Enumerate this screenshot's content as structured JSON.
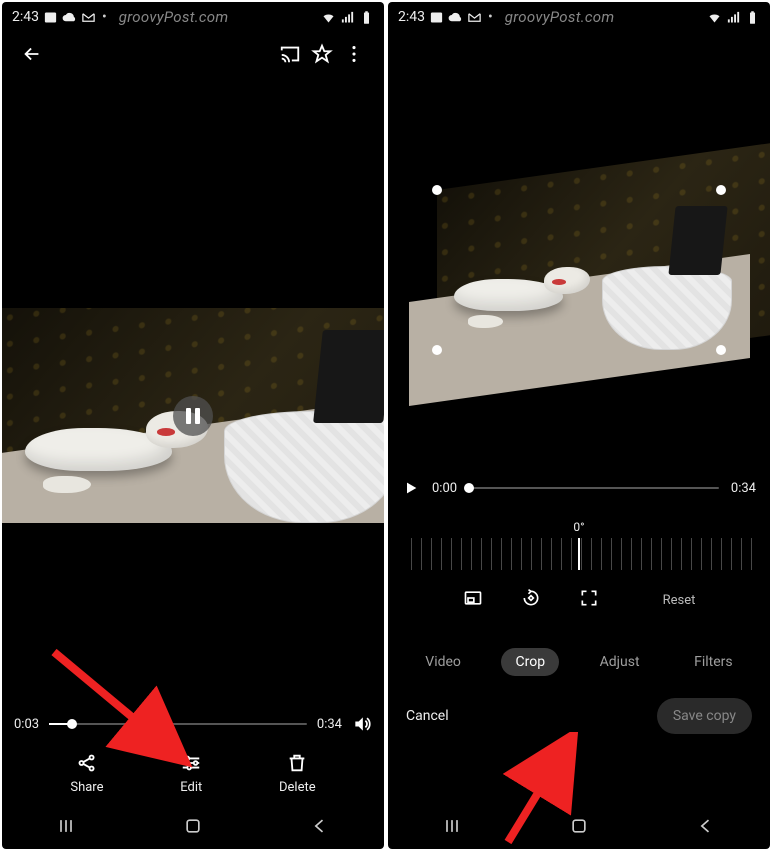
{
  "watermark": "groovyPost.com",
  "status": {
    "time": "2:43"
  },
  "left": {
    "seek": {
      "current": "0:03",
      "total": "0:34",
      "progress_pct": 9
    },
    "actions": {
      "share": "Share",
      "edit": "Edit",
      "delete": "Delete"
    }
  },
  "right": {
    "seek": {
      "current": "0:00",
      "total": "0:34",
      "progress_pct": 0
    },
    "angle": "0°",
    "crop_tools": {
      "reset": "Reset"
    },
    "tabs": {
      "video": "Video",
      "crop": "Crop",
      "adjust": "Adjust",
      "filters": "Filters"
    },
    "bottom": {
      "cancel": "Cancel",
      "save": "Save copy"
    }
  }
}
